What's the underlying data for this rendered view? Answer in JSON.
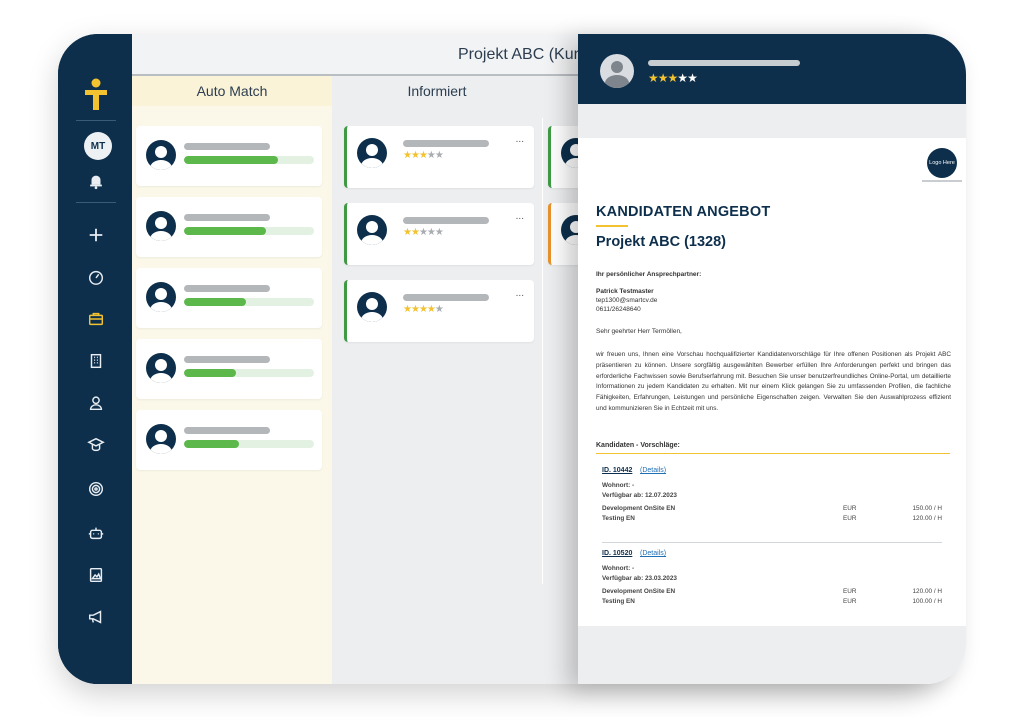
{
  "app": {
    "project_title": "Projekt ABC (Kur",
    "user_initials": "MT"
  },
  "sidebar": {
    "icons": [
      "plus-icon",
      "gauge-icon",
      "briefcase-icon",
      "building-icon",
      "user-icon",
      "graduate-icon",
      "target-icon",
      "robot-icon",
      "image-file-icon",
      "megaphone-icon"
    ],
    "active": "briefcase-icon",
    "accent": "#f2c230",
    "bg": "#0d2f4c"
  },
  "board": {
    "columns": [
      {
        "label": "Auto Match"
      },
      {
        "label": "Informiert"
      },
      {
        "label": ""
      }
    ],
    "auto_match_cards": [
      {
        "match": 0.72
      },
      {
        "match": 0.63
      },
      {
        "match": 0.48
      },
      {
        "match": 0.4
      },
      {
        "match": 0.42
      }
    ],
    "informiert_cards": [
      {
        "stars": 3,
        "accent": "#3e9a43",
        "menu": "..."
      },
      {
        "stars": 2,
        "accent": "#3e9a43",
        "menu": "..."
      },
      {
        "stars": 4,
        "accent": "#3e9a43",
        "menu": "..."
      }
    ],
    "third_cards": [
      {
        "accent": "#3e9a43"
      },
      {
        "accent": "#e8922d"
      }
    ]
  },
  "document": {
    "header_stars": 3,
    "logo_text": "Logo Here",
    "title": "KANDIDATEN ANGEBOT",
    "project": "Projekt ABC (1328)",
    "contact_label": "Ihr persönlicher Ansprechpartner:",
    "contact_name": "Patrick Testmaster",
    "contact_email": "tep1300@smartcv.de",
    "contact_phone": "0611/26248640",
    "salutation": "Sehr geehrter Herr Termöllen,",
    "paragraph": "wir freuen uns, Ihnen eine Vorschau hochqualifizierter Kandidatenvorschläge für Ihre offenen Positionen als Projekt ABC präsentieren zu können. Unsere sorgfältig ausgewählten Bewerber erfüllen Ihre Anforderungen perfekt und bringen das erforderliche Fachwissen sowie Berufserfahrung mit. Besuchen Sie unser benutzerfreundliches Online-Portal, um detaillierte Informationen zu jedem Kandidaten zu erhalten. Mit nur einem Klick gelangen Sie zu umfassenden Profilen, die fachliche Fähigkeiten, Erfahrungen, Leistungen und persönliche Eigenschaften zeigen. Verwalten Sie den Auswahlprozess effizient und kommunizieren Sie in Echtzeit mit uns.",
    "section_title": "Kandidaten - Vorschläge:",
    "candidates": [
      {
        "id": "ID. 10442",
        "details": "(Details)",
        "wohnort": "Wohnort: -",
        "verfuegbar": "Verfügbar ab: 12.07.2023",
        "rates": [
          {
            "label": "Development OnSite EN",
            "currency": "EUR",
            "rate": "150.00 / H"
          },
          {
            "label": "Testing EN",
            "currency": "EUR",
            "rate": "120.00 / H"
          }
        ]
      },
      {
        "id": "ID. 10520",
        "details": "(Details)",
        "wohnort": "Wohnort: -",
        "verfuegbar": "Verfügbar ab: 23.03.2023",
        "rates": [
          {
            "label": "Development OnSite EN",
            "currency": "EUR",
            "rate": "120.00 / H"
          },
          {
            "label": "Testing EN",
            "currency": "EUR",
            "rate": "100.00 / H"
          }
        ]
      }
    ]
  }
}
